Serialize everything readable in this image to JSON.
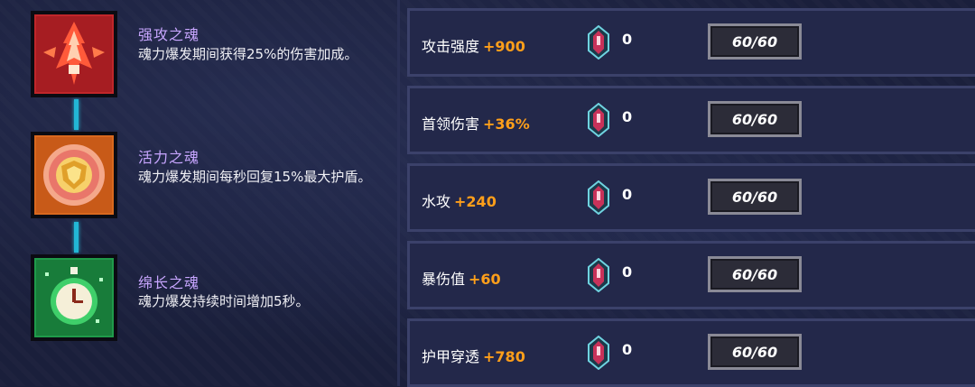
{
  "souls": [
    {
      "icon": "flame-dagger-icon",
      "title": "强攻之魂",
      "description": "魂力爆发期间获得25%的伤害加成。",
      "color": "#c0262a"
    },
    {
      "icon": "shield-emblem-icon",
      "title": "活力之魂",
      "description": "魂力爆发期间每秒回复15%最大护盾。",
      "color": "#d9681e"
    },
    {
      "icon": "stopwatch-icon",
      "title": "绵长之魂",
      "description": "魂力爆发持续时间增加5秒。",
      "color": "#1f9a4a"
    }
  ],
  "stats": [
    {
      "name": "攻击强度",
      "bonus": "+900",
      "gem_count": "0",
      "level": "60/60"
    },
    {
      "name": "首领伤害",
      "bonus": "+36%",
      "gem_count": "0",
      "level": "60/60"
    },
    {
      "name": "水攻",
      "bonus": "+240",
      "gem_count": "0",
      "level": "60/60"
    },
    {
      "name": "暴伤值",
      "bonus": "+60",
      "gem_count": "0",
      "level": "60/60"
    },
    {
      "name": "护甲穿透",
      "bonus": "+780",
      "gem_count": "0",
      "level": "60/60"
    }
  ],
  "colors": {
    "accent_bonus": "#ff9f1a",
    "soul_title": "#c8a6ff",
    "connector": "#22b7d6"
  }
}
